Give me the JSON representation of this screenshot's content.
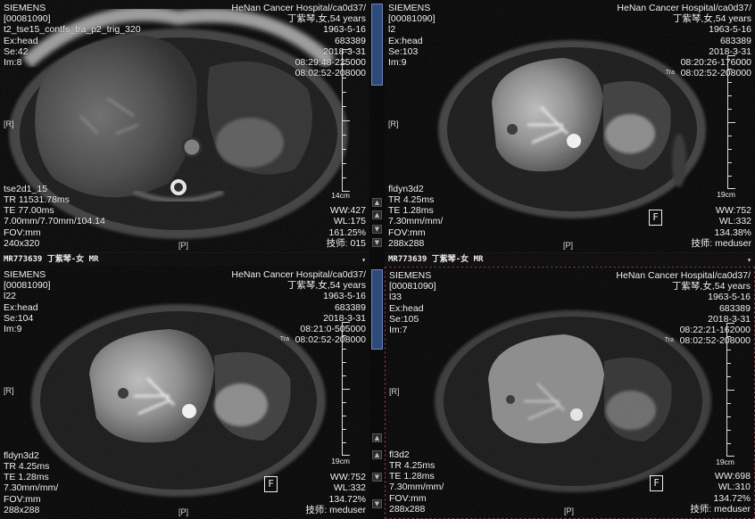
{
  "strips": [
    {
      "label": "MR773639 丁紫琴-女 MR"
    },
    {
      "label": "MR773639 丁紫琴-女 MR"
    }
  ],
  "panels": [
    {
      "tl": [
        "SIEMENS",
        "[00081090]",
        "t2_tse15_contfs_tra_p2_trig_320",
        "Ex:head",
        "Se:42",
        "Im:8"
      ],
      "tr": [
        "HeNan Cancer Hospital/ca0d37/",
        "丁紫琴,女,54 years",
        "1963-5-16",
        "683389",
        "2018-3-31",
        "08:29:48-225000",
        "08:02:52-208000"
      ],
      "bl": [
        "tse2d1_15",
        "TR 11531.78ms",
        "TE 77.00ms",
        "7.00mm/7.70mm/104.14",
        "FOV:mm",
        "240x320"
      ],
      "br": [
        "WW:427",
        "WL:175",
        "161.25%",
        "技师:  015"
      ],
      "left_marker": "[R]",
      "bottom_marker": "[P]",
      "ruler_label": "14cm",
      "tra_mark": "",
      "f_marker": ""
    },
    {
      "tl": [
        "SIEMENS",
        "[00081090]",
        "l2",
        "Ex:head",
        "Se:103",
        "Im:9"
      ],
      "tr": [
        "HeNan Cancer Hospital/ca0d37/",
        "丁紫琴,女,54 years",
        "1963-5-16",
        "683389",
        "2018-3-31",
        "08:20:26-176000",
        "08:02:52-208000"
      ],
      "bl": [
        "fldyn3d2",
        "TR 4.25ms",
        "TE 1.28ms",
        "7.30mm/mm/",
        "FOV:mm",
        "288x288"
      ],
      "br": [
        "WW:752",
        "WL:332",
        "134.38%",
        "技师:  meduser"
      ],
      "left_marker": "[R]",
      "bottom_marker": "[P]",
      "ruler_label": "19cm",
      "tra_mark": "Tra",
      "f_marker": "F"
    },
    {
      "tl": [
        "SIEMENS",
        "[00081090]",
        "l22",
        "Ex:head",
        "Se:104",
        "Im:9"
      ],
      "tr": [
        "HeNan Cancer Hospital/ca0d37/",
        "丁紫琴,女,54 years",
        "1963-5-16",
        "683389",
        "2018-3-31",
        "08:21:0-505000",
        "08:02:52-208000"
      ],
      "bl": [
        "fldyn3d2",
        "TR 4.25ms",
        "TE 1.28ms",
        "7.30mm/mm/",
        "FOV:mm",
        "288x288"
      ],
      "br": [
        "WW:752",
        "WL:332",
        "134.72%",
        "技师:  meduser"
      ],
      "left_marker": "[R]",
      "bottom_marker": "[P]",
      "ruler_label": "19cm",
      "tra_mark": "Tra",
      "f_marker": "F"
    },
    {
      "tl": [
        "SIEMENS",
        "[00081090]",
        "l33",
        "Ex:head",
        "Se:105",
        "Im:7"
      ],
      "tr": [
        "HeNan Cancer Hospital/ca0d37/",
        "丁紫琴,女,54 years",
        "1963-5-16",
        "683389",
        "2018-3-31",
        "08:22:21-162000",
        "08:02:52-208000"
      ],
      "bl": [
        "fl3d2",
        "TR 4.25ms",
        "TE 1.28ms",
        "7.30mm/mm/",
        "FOV:mm",
        "288x288"
      ],
      "br": [
        "WW:698",
        "WL:310",
        "134.72%",
        "技师:  meduser"
      ],
      "left_marker": "[R]",
      "bottom_marker": "[P]",
      "ruler_label": "19cm",
      "tra_mark": "Tra",
      "f_marker": "F"
    }
  ]
}
